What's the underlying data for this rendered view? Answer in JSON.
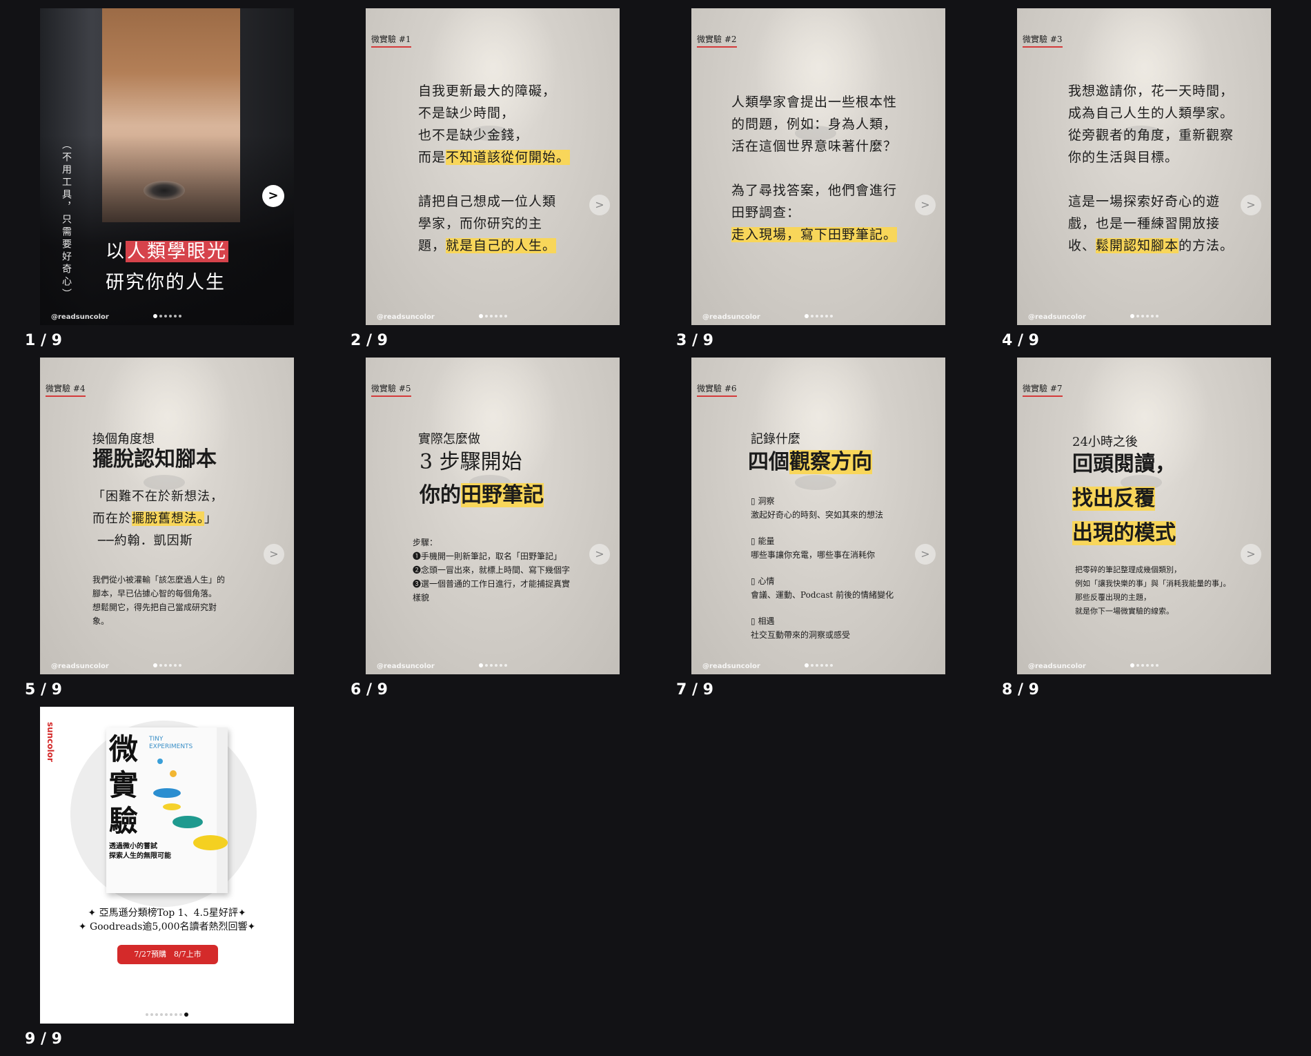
{
  "captions": [
    "1 / 9",
    "2 / 9",
    "3 / 9",
    "4 / 9",
    "5 / 9",
    "6 / 9",
    "7 / 9",
    "8 / 9",
    "9 / 9"
  ],
  "handle": "@readsuncolor",
  "nav_icon": "chevron-right-icon",
  "colors": {
    "highlight": "#f8d65a",
    "tag_underline": "#d43a3a",
    "cover_red": "#d6434b",
    "cta_red": "#d42a2a",
    "background": "#121215"
  },
  "card1": {
    "vertical_text": "（不用工具，只需要好奇心）",
    "title_line1_pre": "以",
    "title_line1_hl": "人類學眼光",
    "title_line2": "研究你的人生"
  },
  "card2": {
    "tag": "微實驗 #1",
    "l1": "自我更新最大的障礙，",
    "l2": "不是缺少時間，",
    "l3": "也不是缺少金錢，",
    "l4_pre": "而是",
    "l4_hl": "不知道該從何開始。",
    "l5": "請把自己想成一位人類",
    "l6": "學家，而你研究的主",
    "l7_pre": "題，",
    "l7_hl": "就是自己的人生。"
  },
  "card3": {
    "tag": "微實驗 #2",
    "l1": "人類學家會提出一些根本性",
    "l2": "的問題，例如：身為人類，",
    "l3": "活在這個世界意味著什麼？",
    "l4": "為了尋找答案，他們會進行",
    "l5": "田野調查：",
    "l6_hl": "走入現場，寫下田野筆記。"
  },
  "card4": {
    "tag": "微實驗 #3",
    "l1": "我想邀請你，花一天時間，",
    "l2": "成為自己人生的人類學家。",
    "l3": "從旁觀者的角度，重新觀察",
    "l4": "你的生活與目標。",
    "l5": "這是一場探索好奇心的遊",
    "l6": "戲，也是一種練習開放接",
    "l7_pre": "收、",
    "l7_hl": "鬆開認知腳本",
    "l7_post": "的方法。"
  },
  "card5": {
    "tag": "微實驗 #4",
    "head1": "換個角度想",
    "head2": "擺脫認知腳本",
    "q1": "「困難不在於新想法，",
    "q2_pre": "而在於",
    "q2_hl": "擺脫舊想法。",
    "q2_post": "」",
    "q3": "──約翰．凱因斯",
    "s1": "我們從小被灌輸「該怎麼過人生」的",
    "s2": "腳本，早已佔據心智的每個角落。",
    "s3": "想鬆開它，得先把自己當成研究對",
    "s4": "象。"
  },
  "card6": {
    "tag": "微實驗 #5",
    "head1": "實際怎麼做",
    "head2a": "3 步驟開始",
    "head2b_pre": "你的",
    "head2b_hl": "田野筆記",
    "steps_label": "步驟：",
    "s1": "❶手機開一則新筆記，取名「田野筆記」",
    "s2": "❷念頭一冒出來，就標上時間、寫下幾個字",
    "s3": "❸選一個普通的工作日進行，才能捕捉真實",
    "s4": "樣貌"
  },
  "card7": {
    "tag": "微實驗 #6",
    "head1": "記錄什麼",
    "head2_pre": "四個",
    "head2_hl": "觀察方向",
    "items": [
      {
        "title": "洞察",
        "desc": "激起好奇心的時刻、突如其來的想法"
      },
      {
        "title": "能量",
        "desc": "哪些事讓你充電，哪些事在消耗你"
      },
      {
        "title": "心情",
        "desc": "會議、運動、Podcast 前後的情緒變化"
      },
      {
        "title": "相遇",
        "desc": "社交互動帶來的洞察或感受"
      }
    ],
    "bullet": "▯"
  },
  "card8": {
    "tag": "微實驗 #7",
    "head1": "24小時之後",
    "head2": "回頭閱讀，",
    "head3_hl": "找出反覆",
    "head4_hl": "出現的模式",
    "s1": "把零碎的筆記整理成幾個類別，",
    "s2": "例如「讓我快樂的事」與「消耗我能量的事」。",
    "s3": "那些反覆出現的主題，",
    "s4": "就是你下一場微實驗的線索。"
  },
  "card9": {
    "brand": "suncolor",
    "book_title": "微實驗",
    "book_en1": "TINY",
    "book_en2": "EXPERIMENTS",
    "book_sub1": "透過微小的嘗試",
    "book_sub2": "探索人生的無限可能",
    "line1": "✦ 亞馬遜分類榜Top 1、4.5星好評✦",
    "line2": "✦ Goodreads逾5,000名讀者熱烈回響✦",
    "cta": "7/27預購　8/7上市"
  }
}
